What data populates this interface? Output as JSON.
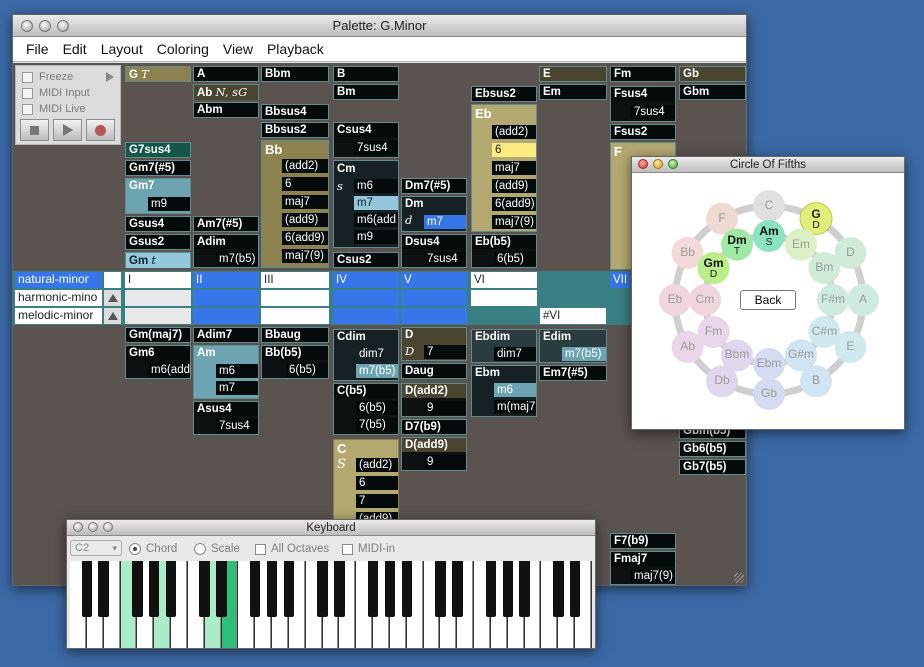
{
  "palette": {
    "title": "Palette: G.Minor",
    "menus": [
      "File",
      "Edit",
      "Layout",
      "Coloring",
      "View",
      "Playback"
    ],
    "controls": {
      "freeze": "Freeze",
      "midi_input": "MIDI Input",
      "midi_live": "MIDI Live"
    },
    "modes": [
      "natural-minor",
      "harmonic-mino",
      "melodic-minor"
    ],
    "numerals": [
      "I",
      "II",
      "III",
      "IV",
      "V",
      "VI",
      "VII"
    ],
    "sharp_vi": "#VI",
    "chords": {
      "g": "G",
      "g_t": "T",
      "gm7sus4": "G7sus4",
      "gm7s5": "Gm7(#5)",
      "gm7": "Gm7",
      "gm7_m9": "m9",
      "gsus4": "Gsus4",
      "gsus2": "Gsus2",
      "gm": "Gm",
      "gm_t": "t",
      "a": "A",
      "ab": "Ab",
      "ab_ext": "N, sG",
      "abm": "Abm",
      "am7s5": "Am7(#5)",
      "adim": "Adim",
      "adim_m7b5": "m7(b5)",
      "bbm": "Bbm",
      "bbsus4": "Bbsus4",
      "bbsus2": "Bbsus2",
      "bb": "Bb",
      "bb_ext": [
        "(add2)",
        "6",
        "maj7",
        "(add9)",
        "6(add9)",
        "maj7(9)"
      ],
      "b": "B",
      "bm": "Bm",
      "csus4": "Csus4",
      "csus4_7": "7sus4",
      "cm": "Cm",
      "cm_s": "s",
      "cm_ext": [
        "m6",
        "m7",
        "m6(add",
        "m9"
      ],
      "csus2": "Csus2",
      "dm7s5": "Dm7(#5)",
      "dm": "Dm",
      "dm_d": "d",
      "dm_m7": "m7",
      "dsus4": "Dsus4",
      "dsus4_7": "7sus4",
      "ebsus2": "Ebsus2",
      "eb": "Eb",
      "eb_ext": [
        "(add2)",
        "6",
        "maj7",
        "(add9)",
        "6(add9)",
        "maj7(9)"
      ],
      "ebb5": "Eb(b5)",
      "ebb5_6": "6(b5)",
      "e": "E",
      "em": "Em",
      "fm": "Fm",
      "fsus4": "Fsus4",
      "fsus4_7": "7sus4",
      "fsus2": "Fsus2",
      "f": "F",
      "gb": "Gb",
      "gbm": "Gbm",
      "gmmaj7": "Gm(maj7)",
      "gm6": "Gm6",
      "gm6_ext": "m6(add",
      "adim7": "Adim7",
      "am": "Am",
      "am_ext": [
        "m6",
        "m7"
      ],
      "asus4": "Asus4",
      "asus4_7": "7sus4",
      "bbaug": "Bbaug",
      "bbb5": "Bb(b5)",
      "bbb5_6": "6(b5)",
      "cdim": "Cdim",
      "cdim_ext": [
        "dim7",
        "m7(b5)"
      ],
      "cb5": "C(b5)",
      "cb5_ext": [
        "6(b5)",
        "7(b5)"
      ],
      "c": "C",
      "c_s": "S",
      "c_ext": [
        "(add2)",
        "6",
        "7",
        "(add9)"
      ],
      "d": "D",
      "d_d": "D",
      "d_7": "7",
      "daug": "Daug",
      "dadd2": "D(add2)",
      "dadd2_9": "9",
      "d7b9": "D7(b9)",
      "dadd9": "D(add9)",
      "dadd9_9": "9",
      "ebdim": "Ebdim",
      "ebdim_dim7": "dim7",
      "ebm": "Ebm",
      "ebm_ext": [
        "m6",
        "m(maj7"
      ],
      "edim": "Edim",
      "edim_m7b5": "m7(b5)",
      "em7s5": "Em7(#5)",
      "gbmb5": "Gbm(b5)",
      "gb6b5": "Gb6(b5)",
      "gb7b5": "Gb7(b5)",
      "f7b9": "F7(b9)",
      "fmaj7": "Fmaj7",
      "fmaj7_9": "maj7(9)"
    }
  },
  "circle": {
    "title": "Circle Of Fifths",
    "back": "Back",
    "outer": [
      "C",
      "G",
      "D",
      "A",
      "E",
      "B",
      "Gb",
      "Db",
      "Ab",
      "Eb",
      "Bb",
      "F"
    ],
    "inner": [
      "Am",
      "Em",
      "Bm",
      "F#m",
      "C#m",
      "G#m",
      "Ebm",
      "Bbm",
      "Fm",
      "Cm",
      "Gm",
      "Dm"
    ],
    "g_label": "D",
    "am_label": "S",
    "dm_label": "T",
    "gm_label": "D"
  },
  "keyboard": {
    "title": "Keyboard",
    "octave": "C2",
    "chord": "Chord",
    "scale": "Scale",
    "all_octaves": "All Octaves",
    "midi_in": "MIDI-in"
  }
}
